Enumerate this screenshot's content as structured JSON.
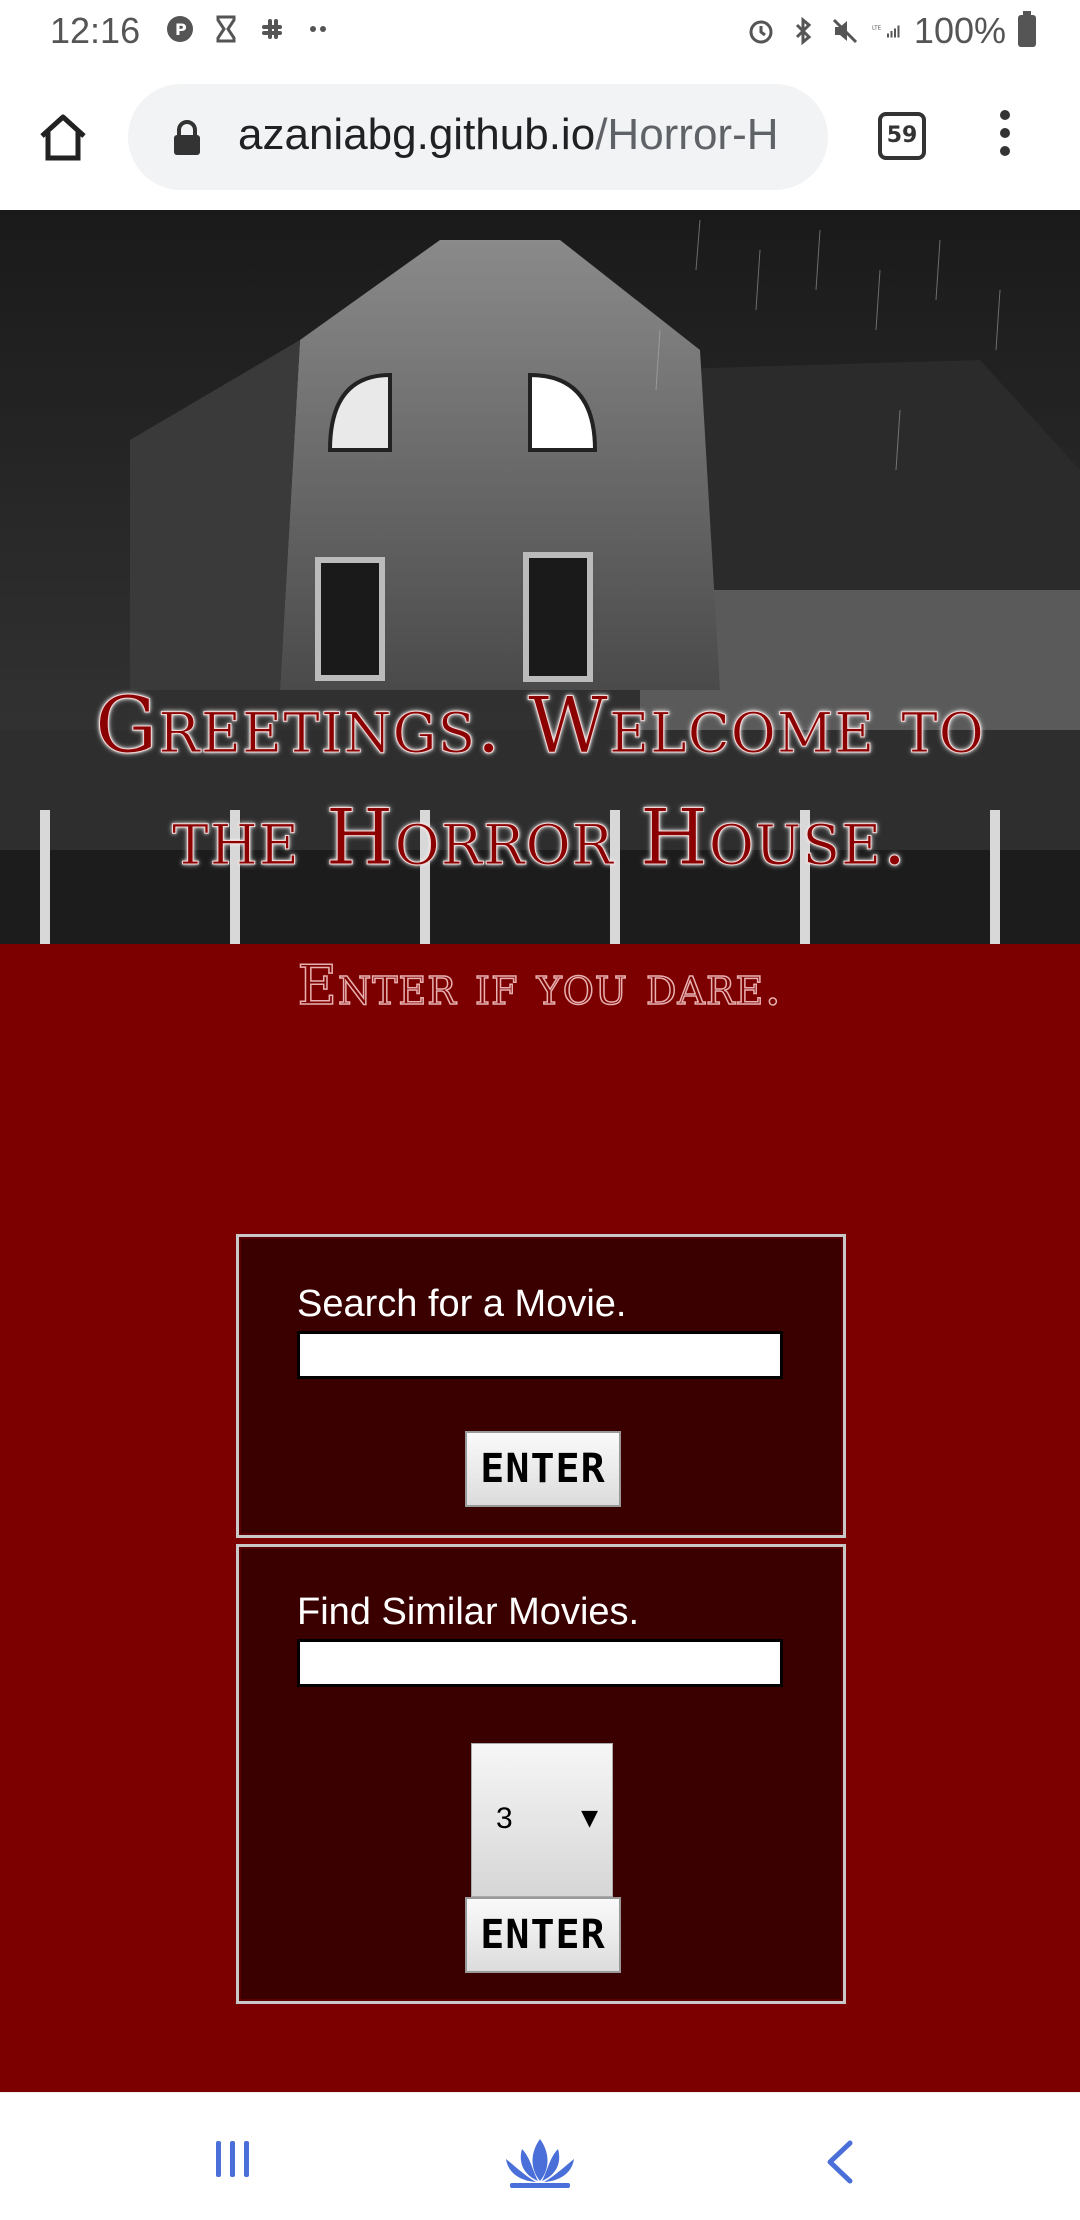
{
  "status": {
    "time": "12:16",
    "battery": "100%",
    "network": "LTE"
  },
  "browser": {
    "url_domain": "azaniabg.github.io",
    "url_path": "/Horror-H",
    "tab_count": "59"
  },
  "hero": {
    "title_line1": "Greetings. Welcome to",
    "title_line2": "the Horror House."
  },
  "main": {
    "tagline": "Enter if you dare."
  },
  "search_panel": {
    "label": "Search for a Movie.",
    "input_value": "",
    "button_label": "ENTER"
  },
  "similar_panel": {
    "label": "Find Similar Movies.",
    "input_value": "",
    "select_value": "3",
    "button_label": "ENTER"
  },
  "icons": {
    "home": "home-icon",
    "lock": "lock-icon",
    "menu": "more-vert-icon",
    "recents": "recents-icon",
    "nav_home": "lotus-home-icon",
    "back": "back-icon"
  },
  "colors": {
    "page_red": "#7c0000",
    "panel_bg": "#3a0000",
    "title_red": "#8b0000",
    "nav_blue": "#4a6fd8"
  }
}
